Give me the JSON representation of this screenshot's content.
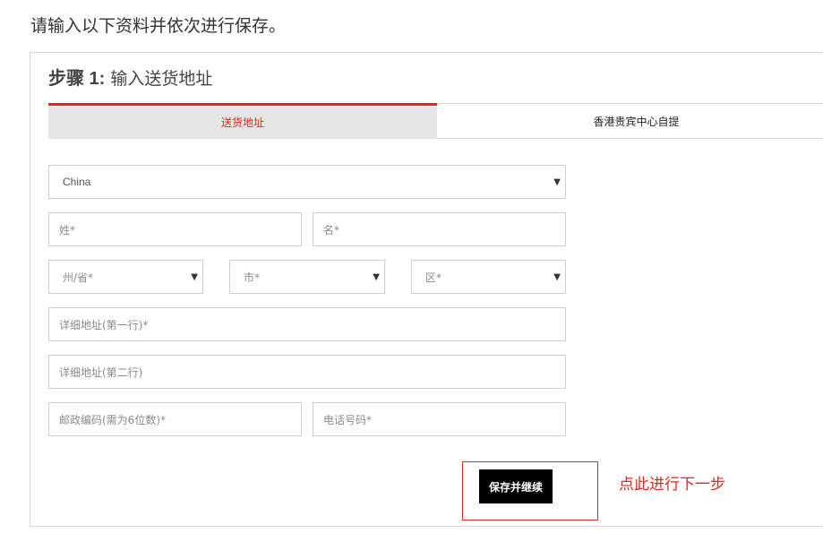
{
  "intro_text": "请输入以下资料并依次进行保存。",
  "step": {
    "number_label": "步骤 1:",
    "title": "输入送货地址"
  },
  "tabs": [
    {
      "label": "送货地址",
      "active": true
    },
    {
      "label": "香港贵宾中心自提",
      "active": false
    }
  ],
  "form": {
    "country": {
      "value": "China"
    },
    "last_name": {
      "placeholder": "姓*"
    },
    "first_name": {
      "placeholder": "名*"
    },
    "province": {
      "value": "州/省*"
    },
    "city": {
      "value": "市*"
    },
    "district": {
      "value": "区*"
    },
    "address_line1": {
      "placeholder": "详细地址(第一行)*"
    },
    "address_line2": {
      "placeholder": "详细地址(第二行)"
    },
    "postal_code": {
      "placeholder": "邮政编码(需为6位数)*"
    },
    "phone": {
      "placeholder": "电话号码*"
    }
  },
  "save_button": {
    "label": "保存并继续"
  },
  "hint_text": "点此进行下一步",
  "colors": {
    "accent_red": "#e8231c",
    "button_black": "#000000",
    "tab_active_bg": "#e5e5e5",
    "border_gray": "#cfcfcf"
  },
  "icons": {
    "select_caret": "▼"
  }
}
